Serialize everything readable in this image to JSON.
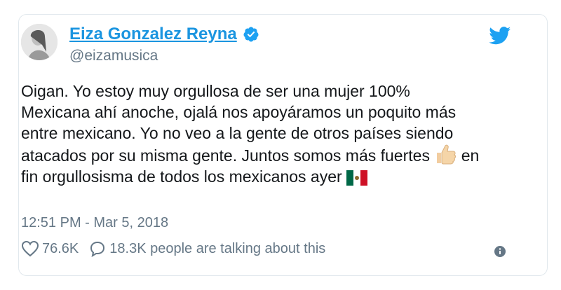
{
  "tweet": {
    "author_name": "Eiza Gonzalez Reyna",
    "handle": "@eizamusica",
    "text_lines": [
      "Oigan. Yo estoy muy orgullosa de ser una mujer 100%",
      "Mexicana ahí anoche, ojalá nos apoyáramos un poquito más",
      "entre mexicano. Yo no veo a la gente de otros países siendo",
      "atacados por su misma gente. Juntos somos más fuertes",
      "en",
      "fin orgullosisma de todos los mexicanos ayer"
    ],
    "timestamp": "12:51 PM - Mar 5, 2018",
    "likes": "76.6K",
    "replies_text": "18.3K people are talking about this"
  },
  "colors": {
    "link_blue": "#1b95e0",
    "gray_text": "#657786",
    "border": "#e1e8ed",
    "like_icon": "#657786"
  },
  "icons": {
    "verified": "verified-badge-icon",
    "bird": "twitter-bird-icon",
    "like": "heart-icon",
    "reply": "speech-bubble-icon",
    "info": "info-icon",
    "thumbs_up": "thumbs-up-emoji",
    "flag": "mexico-flag-emoji"
  }
}
